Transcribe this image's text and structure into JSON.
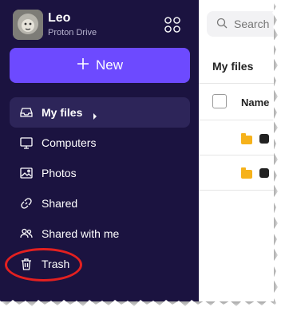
{
  "user": {
    "name": "Leo",
    "app": "Proton Drive"
  },
  "sidebar": {
    "new_label": "New",
    "items": [
      {
        "label": "My files",
        "icon": "inbox-icon",
        "active": true
      },
      {
        "label": "Computers",
        "icon": "monitor-icon"
      },
      {
        "label": "Photos",
        "icon": "image-icon"
      },
      {
        "label": "Shared",
        "icon": "link-icon"
      },
      {
        "label": "Shared with me",
        "icon": "users-icon"
      },
      {
        "label": "Trash",
        "icon": "trash-icon"
      }
    ]
  },
  "main": {
    "search_placeholder": "Search",
    "title": "My files",
    "column_name": "Name"
  },
  "colors": {
    "sidebar": "#1b1340",
    "accent": "#6d4aff",
    "highlight": "#e32020",
    "folder": "#f6b21b"
  }
}
